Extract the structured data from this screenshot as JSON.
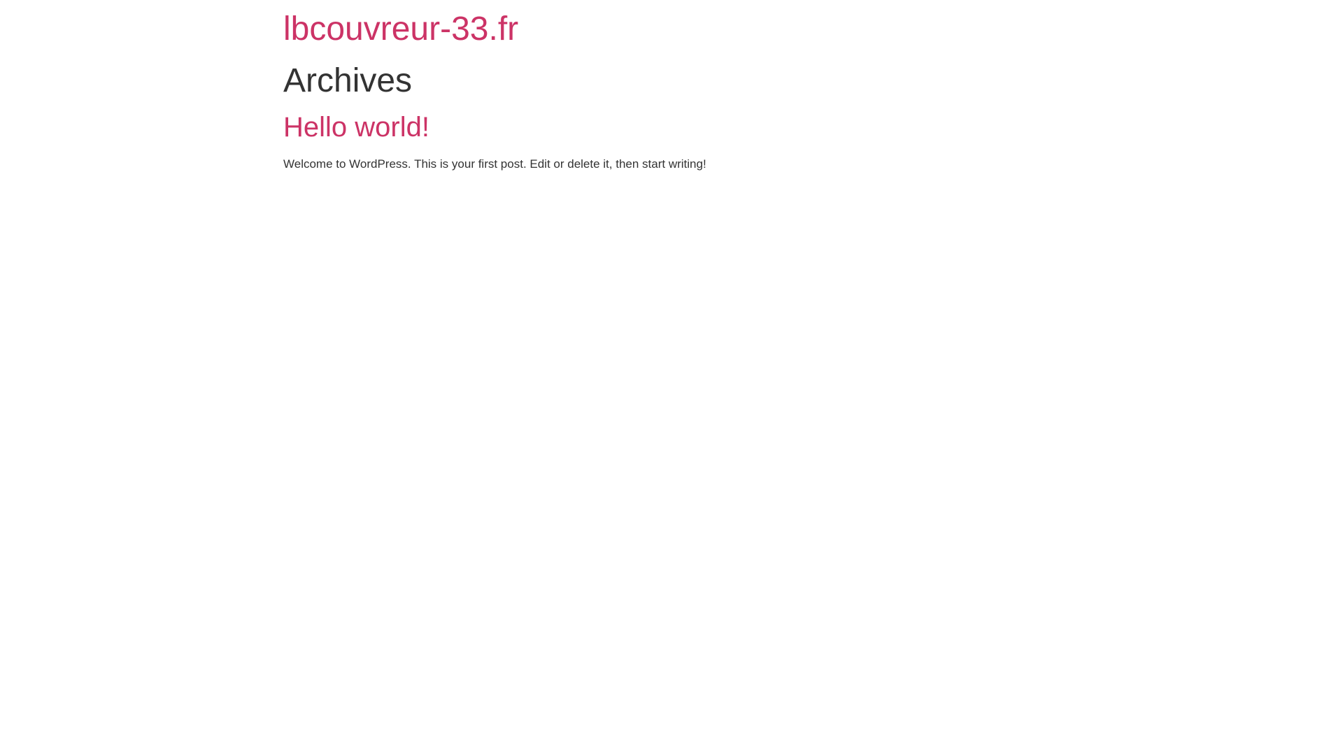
{
  "site": {
    "title": "lbcouvreur-33.fr"
  },
  "archive": {
    "heading": "Archives"
  },
  "posts": [
    {
      "title": "Hello world!",
      "excerpt": "Welcome to WordPress. This is your first post. Edit or delete it, then start writing!"
    }
  ],
  "colors": {
    "link": "#cc3366",
    "text": "#333333",
    "background": "#ffffff"
  }
}
